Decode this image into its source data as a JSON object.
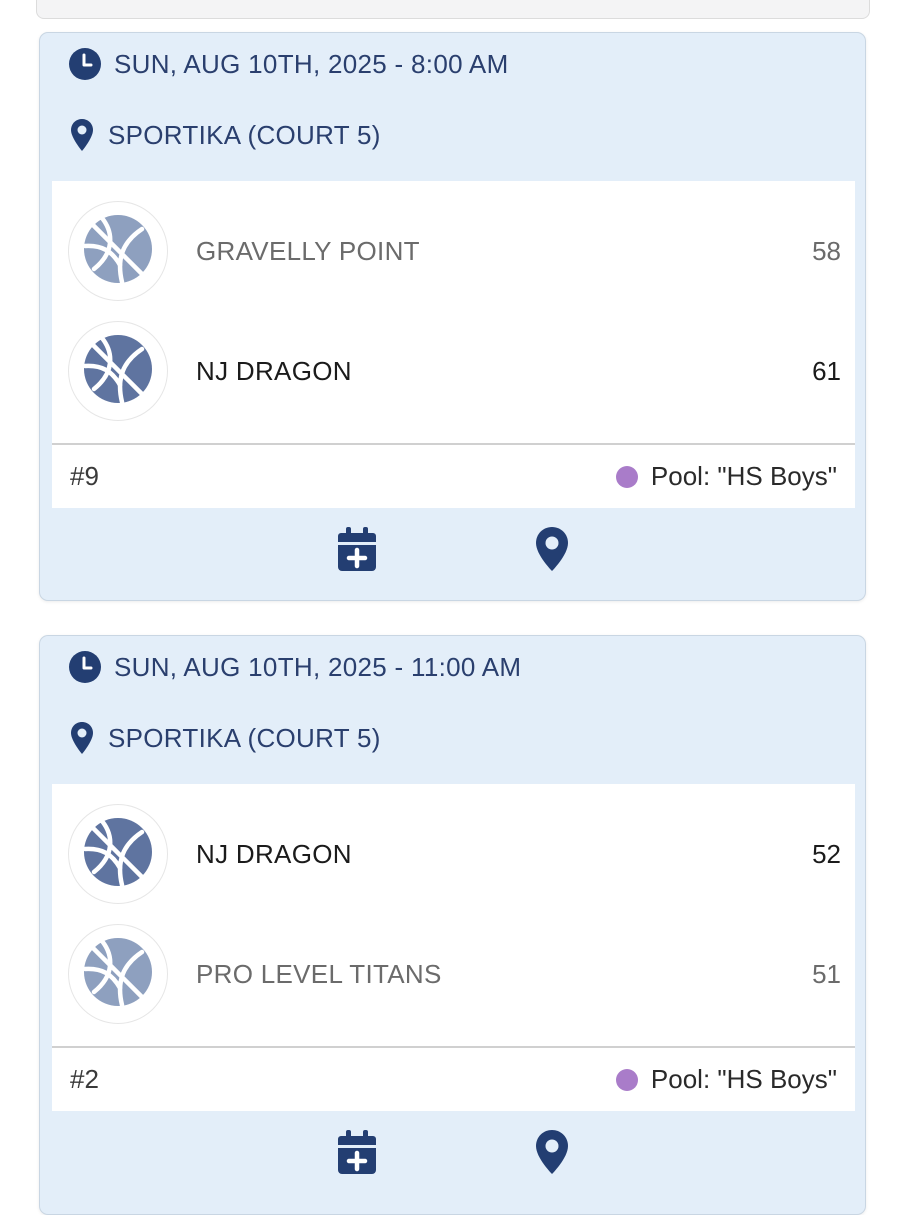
{
  "colors": {
    "card_bg": "#e3eef9",
    "accent": "#2a3f6e",
    "icon_navy": "#233e72",
    "pool_dot": "#a97cc9",
    "logo_winner": "#5f74a0",
    "logo_loser": "#8ea0bf"
  },
  "games": [
    {
      "datetime": "SUN, AUG 10TH, 2025 - 8:00 AM",
      "location": "SPORTIKA (COURT 5)",
      "teams": [
        {
          "name": "GRAVELLY POINT",
          "score": "58",
          "logo_icon": "basketball-icon"
        },
        {
          "name": "NJ DRAGON",
          "score": "61",
          "logo_icon": "basketball-icon"
        }
      ],
      "game_number": "#9",
      "pool": "Pool: \"HS Boys\""
    },
    {
      "datetime": "SUN, AUG 10TH, 2025 - 11:00 AM",
      "location": "SPORTIKA (COURT 5)",
      "teams": [
        {
          "name": "NJ DRAGON",
          "score": "52",
          "logo_icon": "basketball-icon"
        },
        {
          "name": "PRO LEVEL TITANS",
          "score": "51",
          "logo_icon": "basketball-icon"
        }
      ],
      "game_number": "#2",
      "pool": "Pool: \"HS Boys\""
    }
  ],
  "icons": {
    "time": "clock-icon",
    "location": "map-pin-icon",
    "add_to_calendar": "calendar-plus-icon",
    "directions": "map-marker-icon"
  }
}
